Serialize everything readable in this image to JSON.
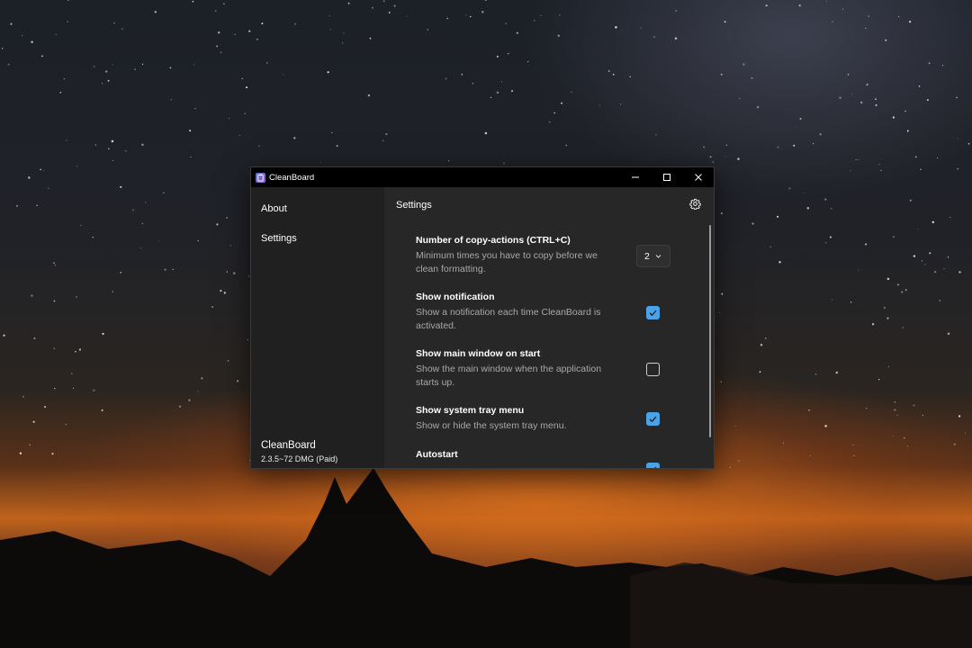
{
  "window": {
    "title": "CleanBoard",
    "controls": [
      "minimize-icon",
      "maximize-icon",
      "close-icon"
    ]
  },
  "sidebar": {
    "items": [
      {
        "label": "About"
      },
      {
        "label": "Settings"
      }
    ],
    "app_name": "CleanBoard",
    "app_version": "2.3.5~72 DMG (Paid)"
  },
  "main": {
    "title": "Settings",
    "settings": [
      {
        "title": "Number of copy-actions (CTRL+C)",
        "description": "Minimum times you have to copy before we clean formatting.",
        "control": "dropdown",
        "value": "2"
      },
      {
        "title": "Show notification",
        "description": "Show a notification each time CleanBoard is activated.",
        "control": "checkbox",
        "checked": true
      },
      {
        "title": "Show main window on start",
        "description": "Show the main window when the application starts up.",
        "control": "checkbox",
        "checked": false
      },
      {
        "title": "Show system tray menu",
        "description": "Show or hide the system tray menu.",
        "control": "checkbox",
        "checked": true
      },
      {
        "title": "Autostart",
        "description": "",
        "control": "checkbox",
        "checked": true
      }
    ]
  },
  "colors": {
    "accent": "#4aa3e8",
    "titlebar": "#000000",
    "sidebar": "#202020",
    "content": "#272727"
  }
}
